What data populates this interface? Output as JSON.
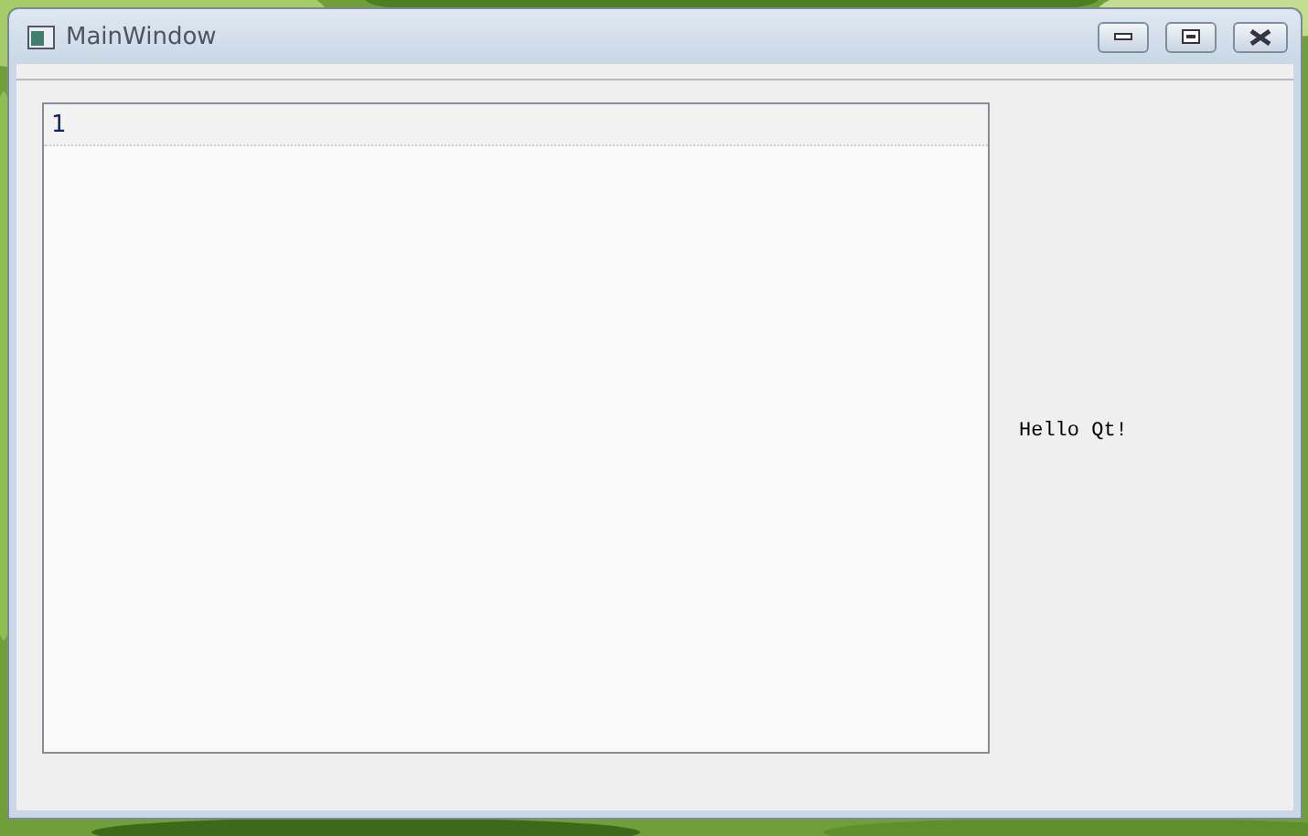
{
  "window": {
    "title": "MainWindow"
  },
  "editor": {
    "lines": [
      {
        "text": "1",
        "current": true
      }
    ]
  },
  "label": {
    "text": "Hello Qt!"
  }
}
